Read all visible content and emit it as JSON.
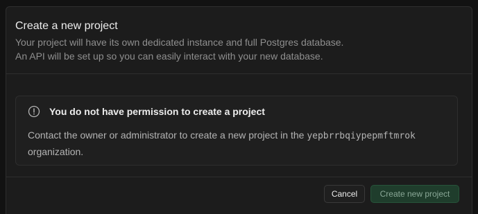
{
  "dialog": {
    "title": "Create a new project",
    "description_line1": "Your project will have its own dedicated instance and full Postgres database.",
    "description_line2": "An API will be set up so you can easily interact with your new database."
  },
  "alert": {
    "icon": "alert-circle-icon",
    "title": "You do not have permission to create a project",
    "body_prefix": "Contact the owner or administrator to create a new project in the ",
    "organization": "yepbrrbqiypepmftmrok",
    "body_suffix": "organization."
  },
  "footer": {
    "cancel_label": "Cancel",
    "create_label": "Create new project",
    "create_disabled": true
  },
  "colors": {
    "background": "#1c1c1c",
    "border": "#2e2e2e",
    "primary_disabled": "#1f3d2c",
    "text_primary": "#ededed",
    "text_muted": "#8f8f8f"
  }
}
